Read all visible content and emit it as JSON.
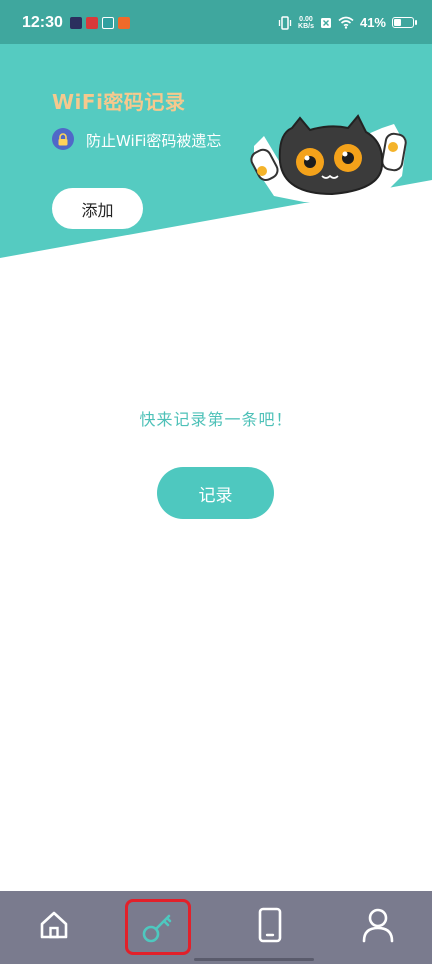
{
  "status_bar": {
    "time": "12:30",
    "net_speed_value": "0.00",
    "net_speed_unit": "KB/s",
    "battery": "41%"
  },
  "header": {
    "title": "WiFi密码记录",
    "subtitle": "防止WiFi密码被遗忘",
    "add_label": "添加"
  },
  "empty_state": {
    "message": "快来记录第一条吧！",
    "record_label": "记录"
  },
  "tabbar": {
    "tabs": [
      {
        "icon": "home-icon"
      },
      {
        "icon": "key-icon",
        "selected": true
      },
      {
        "icon": "phone-icon"
      },
      {
        "icon": "user-icon"
      }
    ]
  },
  "colors": {
    "status_bar": "#3fa79e",
    "hero": "#55cbc1",
    "accent": "#4ec8bf",
    "title": "#f6c98e",
    "tabbar": "#7a7b8e",
    "selected_outline": "#e2202a"
  }
}
